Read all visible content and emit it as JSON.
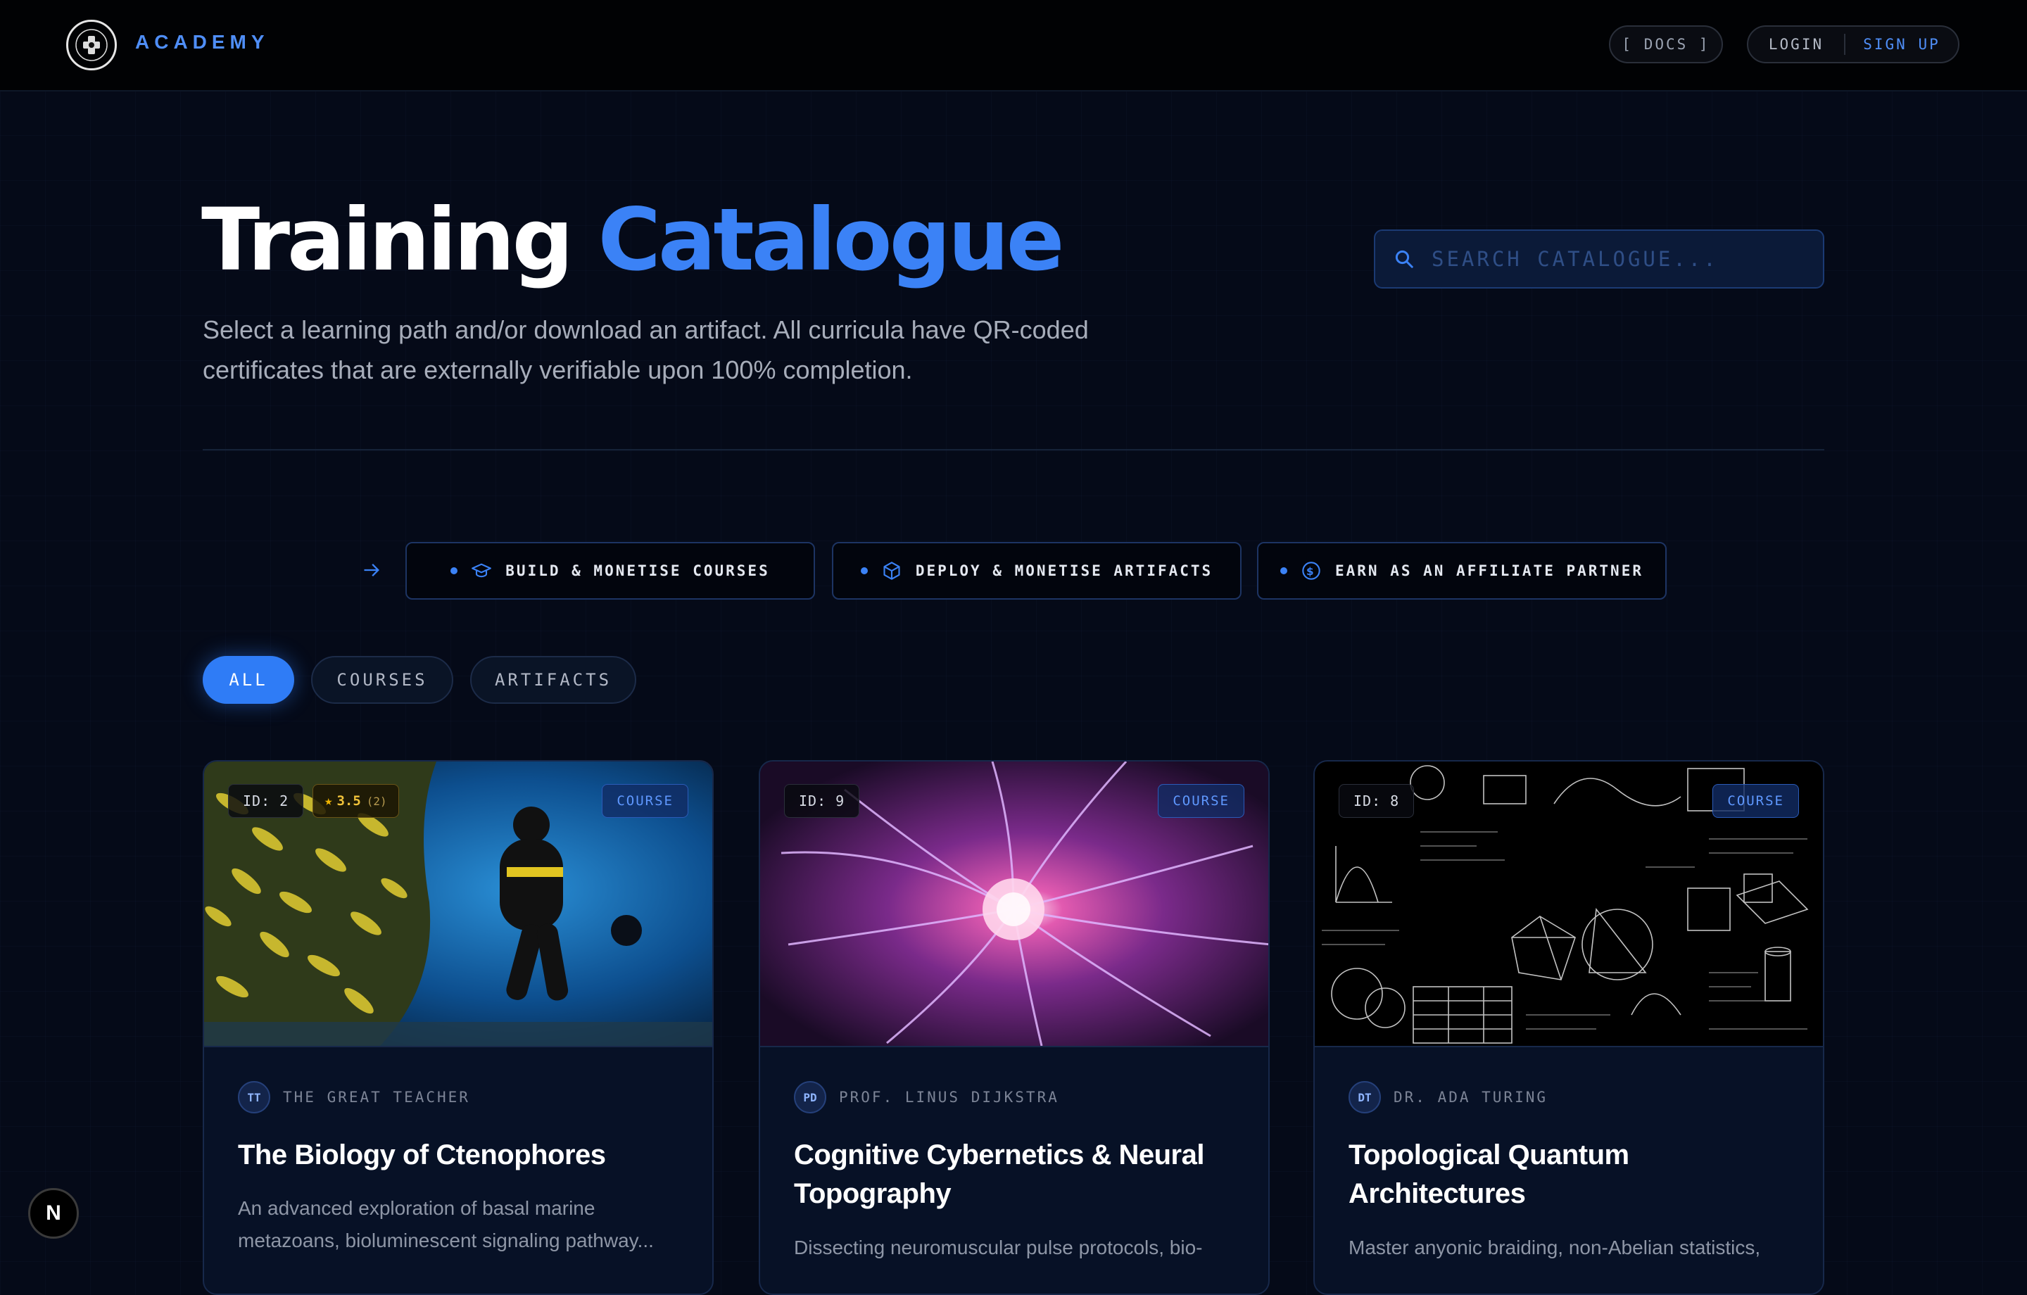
{
  "header": {
    "brand": "ACADEMY",
    "docs_label": "[ DOCS ]",
    "login_label": "LOGIN",
    "signup_label": "SIGN UP"
  },
  "hero": {
    "title_part1": "Training",
    "title_part2": "Catalogue",
    "subtitle": "Select a learning path and/or download an artifact. All curricula have QR-coded certificates that are externally verifiable upon 100% completion.",
    "search_placeholder": "SEARCH CATALOGUE..."
  },
  "actions": [
    {
      "label": "BUILD & MONETISE COURSES",
      "icon": "graduation-cap-icon"
    },
    {
      "label": "DEPLOY & MONETISE ARTIFACTS",
      "icon": "cube-icon"
    },
    {
      "label": "EARN AS AN AFFILIATE PARTNER",
      "icon": "dollar-circle-icon"
    }
  ],
  "filters": [
    {
      "label": "ALL",
      "active": true
    },
    {
      "label": "COURSES",
      "active": false
    },
    {
      "label": "ARTIFACTS",
      "active": false
    }
  ],
  "cards": [
    {
      "id_label": "ID: 2",
      "rating": "3.5",
      "rating_count": "(2)",
      "type": "COURSE",
      "author_initials": "TT",
      "author": "THE GREAT TEACHER",
      "title": "The Biology of Ctenophores",
      "description": "An advanced exploration of basal marine metazoans, bioluminescent signaling pathway..."
    },
    {
      "id_label": "ID: 9",
      "type": "COURSE",
      "author_initials": "PD",
      "author": "PROF. LINUS DIJKSTRA",
      "title": "Cognitive Cybernetics & Neural Topography",
      "description": "Dissecting neuromuscular pulse protocols, bio-"
    },
    {
      "id_label": "ID: 8",
      "type": "COURSE",
      "author_initials": "DT",
      "author": "DR. ADA TURING",
      "title": "Topological Quantum Architectures",
      "description": "Master anyonic braiding, non-Abelian statistics,"
    }
  ],
  "fab_label": "N",
  "colors": {
    "accent": "#3b82f6",
    "background": "#050a18",
    "rating": "#f0c23a"
  }
}
